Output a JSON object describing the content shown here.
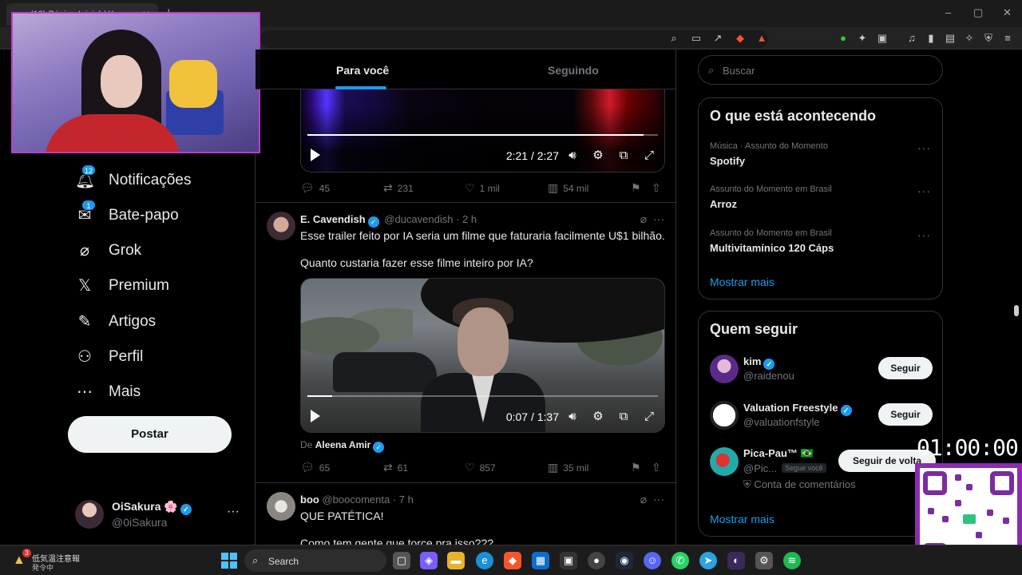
{
  "browser": {
    "tab_title": "(12) Página Inicial / X",
    "tab_close": "✕",
    "new_tab": "+",
    "window_controls": {
      "minimize": "–",
      "maximize": "▢",
      "close": "✕"
    }
  },
  "nav": {
    "items": [
      {
        "label": "Notificações",
        "icon": "bell-icon",
        "badge": "12"
      },
      {
        "label": "Bate-papo",
        "icon": "mail-icon",
        "badge": "1"
      },
      {
        "label": "Grok",
        "icon": "grok-icon"
      },
      {
        "label": "Premium",
        "icon": "x-logo-icon"
      },
      {
        "label": "Artigos",
        "icon": "article-icon"
      },
      {
        "label": "Perfil",
        "icon": "person-icon"
      },
      {
        "label": "Mais",
        "icon": "more-circle-icon"
      }
    ],
    "post_button": "Postar",
    "profile": {
      "name": "OiSakura 🌸",
      "handle": "@0iSakura",
      "more": "···"
    }
  },
  "feed": {
    "tabs": [
      {
        "label": "Para você",
        "active": true
      },
      {
        "label": "Seguindo",
        "active": false
      }
    ],
    "tweet0": {
      "video_time": "2:21 / 2:27",
      "video_progress": 0.96,
      "replies": "45",
      "reposts": "231",
      "likes": "1 mil",
      "views": "54 mil"
    },
    "tweet1": {
      "name": "E. Cavendish",
      "handle": "@ducavendish",
      "time": "· 2 h",
      "text1": "Esse trailer feito por IA seria um filme que faturaria facilmente U$1 bilhão.",
      "text2": "Quanto custaria fazer esse filme inteiro por IA?",
      "video_time": "0:07 / 1:37",
      "video_progress": 0.07,
      "from_prefix": "De",
      "from_name": "Aleena Amir",
      "replies": "65",
      "reposts": "61",
      "likes": "857",
      "views": "35 mil"
    },
    "tweet2": {
      "name": "boo",
      "handle": "@boocomenta",
      "time": "· 7 h",
      "text1": "QUE PATÉTICA!",
      "text2": "Como tem gente que torce pra isso???"
    }
  },
  "right": {
    "search_placeholder": "Buscar",
    "trends_title": "O que está acontecendo",
    "trends": [
      {
        "context": "Música · Assunto do Momento",
        "name": "Spotify"
      },
      {
        "context": "Assunto do Momento em Brasil",
        "name": "Arroz"
      },
      {
        "context": "Assunto do Momento em Brasil",
        "name": "Multivitamínico 120 Cáps"
      }
    ],
    "trends_more": "Mostrar mais",
    "who_title": "Quem seguir",
    "who": [
      {
        "name": "kim",
        "handle": "@raidenou",
        "button": "Seguir"
      },
      {
        "name": "Valuation Freestyle",
        "handle": "@valuationfstyle",
        "button": "Seguir"
      },
      {
        "name": "Pica-Pau™ 🇧🇷",
        "handle": "@Pic...",
        "follows_you": "Segue você",
        "note": "Conta de comentários",
        "button": "Seguir de volta"
      }
    ],
    "who_more": "Mostrar mais"
  },
  "overlay": {
    "timer": "01:00:00"
  },
  "taskbar": {
    "weather_line1": "低気温注意報",
    "weather_line2": "発令中",
    "weather_badge": "3",
    "search_label": "Search"
  },
  "colors": {
    "accent": "#1d9bf0",
    "background": "#000000",
    "text": "#e7e9ea",
    "muted": "#71767b",
    "border": "#2f3336",
    "stream_frame": "#c03bd0"
  }
}
